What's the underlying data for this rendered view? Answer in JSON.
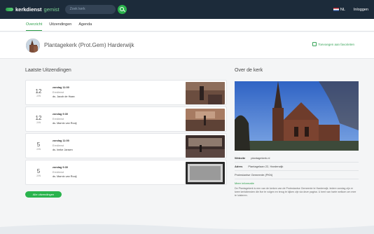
{
  "brand": {
    "name_bold": "kerkdienst",
    "name_light": "gemist"
  },
  "search": {
    "placeholder": "Zoek kerk"
  },
  "top_right": {
    "language": "NL",
    "login": "Inloggen"
  },
  "nav": {
    "tabs": [
      "Overzicht",
      "Uitzendingen",
      "Agenda"
    ]
  },
  "church": {
    "name": "Plantagekerk (Prot.Gem) Harderwijk",
    "favorite_label": "Toevoegen aan favorieten"
  },
  "broadcasts": {
    "title": "Laatste Uitzendingen",
    "items": [
      {
        "day": "12",
        "month": "JAN",
        "when": "zondag 11:00",
        "type": "Eredienst",
        "speaker": "ds. Jacob de Haan"
      },
      {
        "day": "12",
        "month": "JAN",
        "when": "zondag 9:30",
        "type": "Eredienst",
        "speaker": "ds. Marnix van Rooij"
      },
      {
        "day": "5",
        "month": "JAN",
        "when": "zondag 11:00",
        "type": "Eredienst",
        "speaker": "ds. Ineke Jansen"
      },
      {
        "day": "5",
        "month": "JAN",
        "when": "zondag 9:30",
        "type": "Eredienst",
        "speaker": "ds. Marnix van Rooij"
      }
    ],
    "more_label": "Alle uitzendingen"
  },
  "about": {
    "title": "Over de kerk",
    "website_label": "Website",
    "website_value": "plantagekerk.nl",
    "address_label": "Adres",
    "address_value": "Plantagelaan 22, Harderwijk",
    "denomination": "Protestantse Gemeente (PKN)",
    "link": "Meer informatie",
    "description": "De Plantagekerk is een van de kerken van de Protestantse Gemeente te Harderwijk. Iedere zondag zijn er twee kerkdiensten die live te volgen en terug te kijken zijn via deze pagina. U bent van harte welkom om mee te luisteren."
  },
  "colors": {
    "topbar": "#1c2b3a",
    "accent": "#2ab34d"
  }
}
